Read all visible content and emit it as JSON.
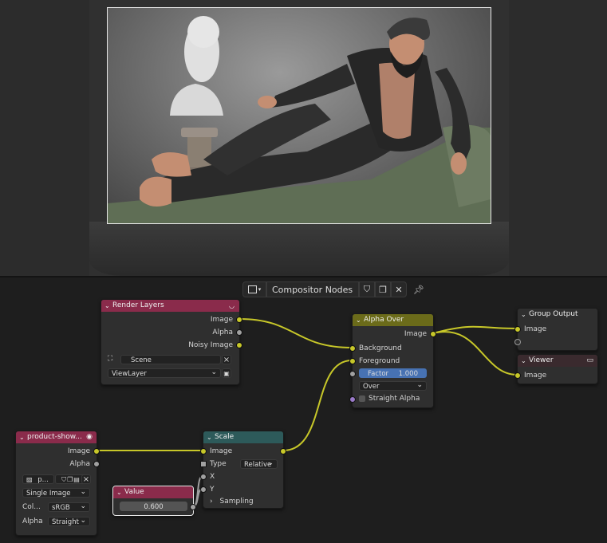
{
  "header": {
    "editor_type_icon": "image-icon",
    "tree_name": "Compositor Nodes",
    "fake_user_icon": "shield-icon",
    "duplicate_icon": "duplicate-icon",
    "unlink_icon": "close-icon",
    "pin_icon": "pin-icon"
  },
  "nodes": {
    "render_layers": {
      "title": "Render Layers",
      "outputs": [
        "Image",
        "Alpha",
        "Noisy Image"
      ],
      "scene": "Scene",
      "view_layer": "ViewLayer"
    },
    "alpha_over": {
      "title": "Alpha Over",
      "output": "Image",
      "inputs": [
        "Background",
        "Foreground"
      ],
      "factor_label": "Factor",
      "factor_value": "1.000",
      "factor_fraction": 1.0,
      "mode": "Over",
      "straight_alpha": "Straight Alpha"
    },
    "group_output": {
      "title": "Group Output",
      "input": "Image"
    },
    "viewer": {
      "title": "Viewer",
      "input": "Image"
    },
    "image": {
      "title": "product-show...",
      "outputs": [
        "Image",
        "Alpha"
      ],
      "image_name": "p...",
      "source": "Single Image",
      "colorspace_label": "Col...",
      "colorspace": "sRGB",
      "alpha_label": "Alpha",
      "alpha_mode": "Straight"
    },
    "scale": {
      "title": "Scale",
      "output": "Image",
      "input": "Image",
      "type_label": "Type",
      "type_value": "Relative",
      "x_label": "X",
      "y_label": "Y",
      "sampling_label": "Sampling"
    },
    "value": {
      "title": "Value",
      "value": "0.600"
    }
  },
  "colors": {
    "input_header": "#8a2b4b",
    "color_header": "#6b6b1a",
    "converter_header": "#2d5a5a",
    "output_header": "#3a2a2e",
    "image_socket": "#c7c729",
    "factor_fill": "#4772b3"
  }
}
